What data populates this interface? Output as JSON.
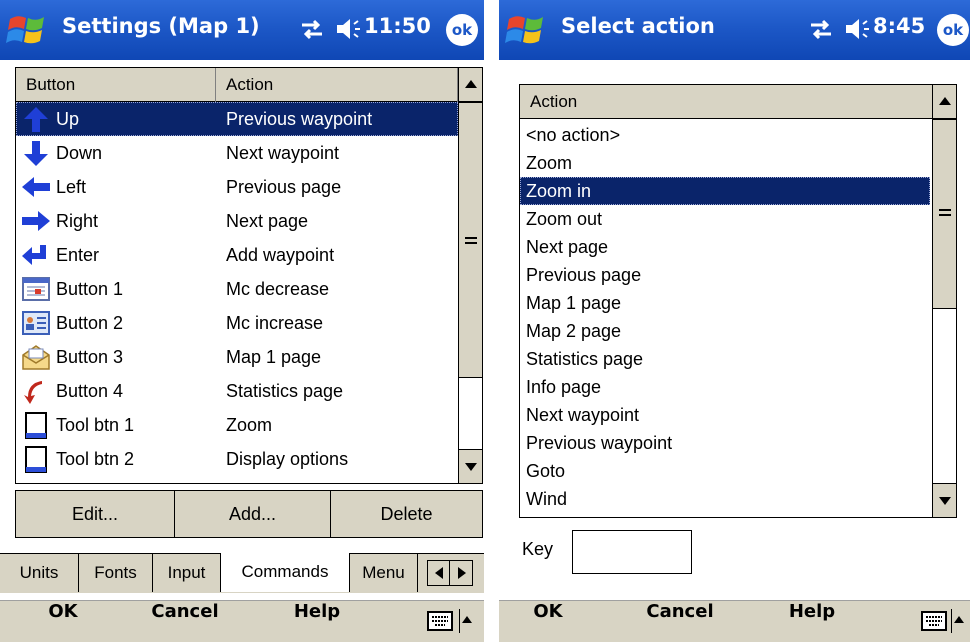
{
  "left": {
    "title": "Settings (Map 1)",
    "time": "11:50",
    "ok_label": "ok",
    "columns": [
      "Button",
      "Action"
    ],
    "rows": [
      {
        "button": "Up",
        "action": "Previous waypoint",
        "icon": "arrow-up-icon"
      },
      {
        "button": "Down",
        "action": "Next waypoint",
        "icon": "arrow-down-icon"
      },
      {
        "button": "Left",
        "action": "Previous page",
        "icon": "arrow-left-icon"
      },
      {
        "button": "Right",
        "action": "Next page",
        "icon": "arrow-right-icon"
      },
      {
        "button": "Enter",
        "action": "Add waypoint",
        "icon": "enter-arrow-icon"
      },
      {
        "button": "Button 1",
        "action": "Mc decrease",
        "icon": "calendar-icon"
      },
      {
        "button": "Button 2",
        "action": "Mc increase",
        "icon": "contacts-icon"
      },
      {
        "button": "Button 3",
        "action": "Map 1 page",
        "icon": "envelope-icon"
      },
      {
        "button": "Button 4",
        "action": "Statistics page",
        "icon": "red-arrow-icon"
      },
      {
        "button": "Tool btn 1",
        "action": "Zoom",
        "icon": "device-icon"
      },
      {
        "button": "Tool btn 2",
        "action": "Display options",
        "icon": "device-icon"
      }
    ],
    "selected_index": 0,
    "buttons": [
      "Edit...",
      "Add...",
      "Delete"
    ],
    "tabs": [
      "Units",
      "Fonts",
      "Input",
      "Commands",
      "Menu"
    ],
    "active_tab": "Commands",
    "softkeys": {
      "ok": "OK",
      "cancel": "Cancel",
      "help": "Help"
    }
  },
  "right": {
    "title": "Select action",
    "time": "8:45",
    "ok_label": "ok",
    "column": "Action",
    "items": [
      "<no action>",
      "Zoom",
      "Zoom in",
      "Zoom out",
      "Next page",
      "Previous page",
      "Map 1 page",
      "Map 2 page",
      "Statistics page",
      "Info page",
      "Next waypoint",
      "Previous waypoint",
      "Goto",
      "Wind"
    ],
    "selected_index": 2,
    "key_label": "Key",
    "key_value": "",
    "softkeys": {
      "ok": "OK",
      "cancel": "Cancel",
      "help": "Help"
    }
  },
  "colors": {
    "titlebar": "#1d58c7",
    "selection": "#0a246a",
    "chrome": "#d8d4c4"
  }
}
